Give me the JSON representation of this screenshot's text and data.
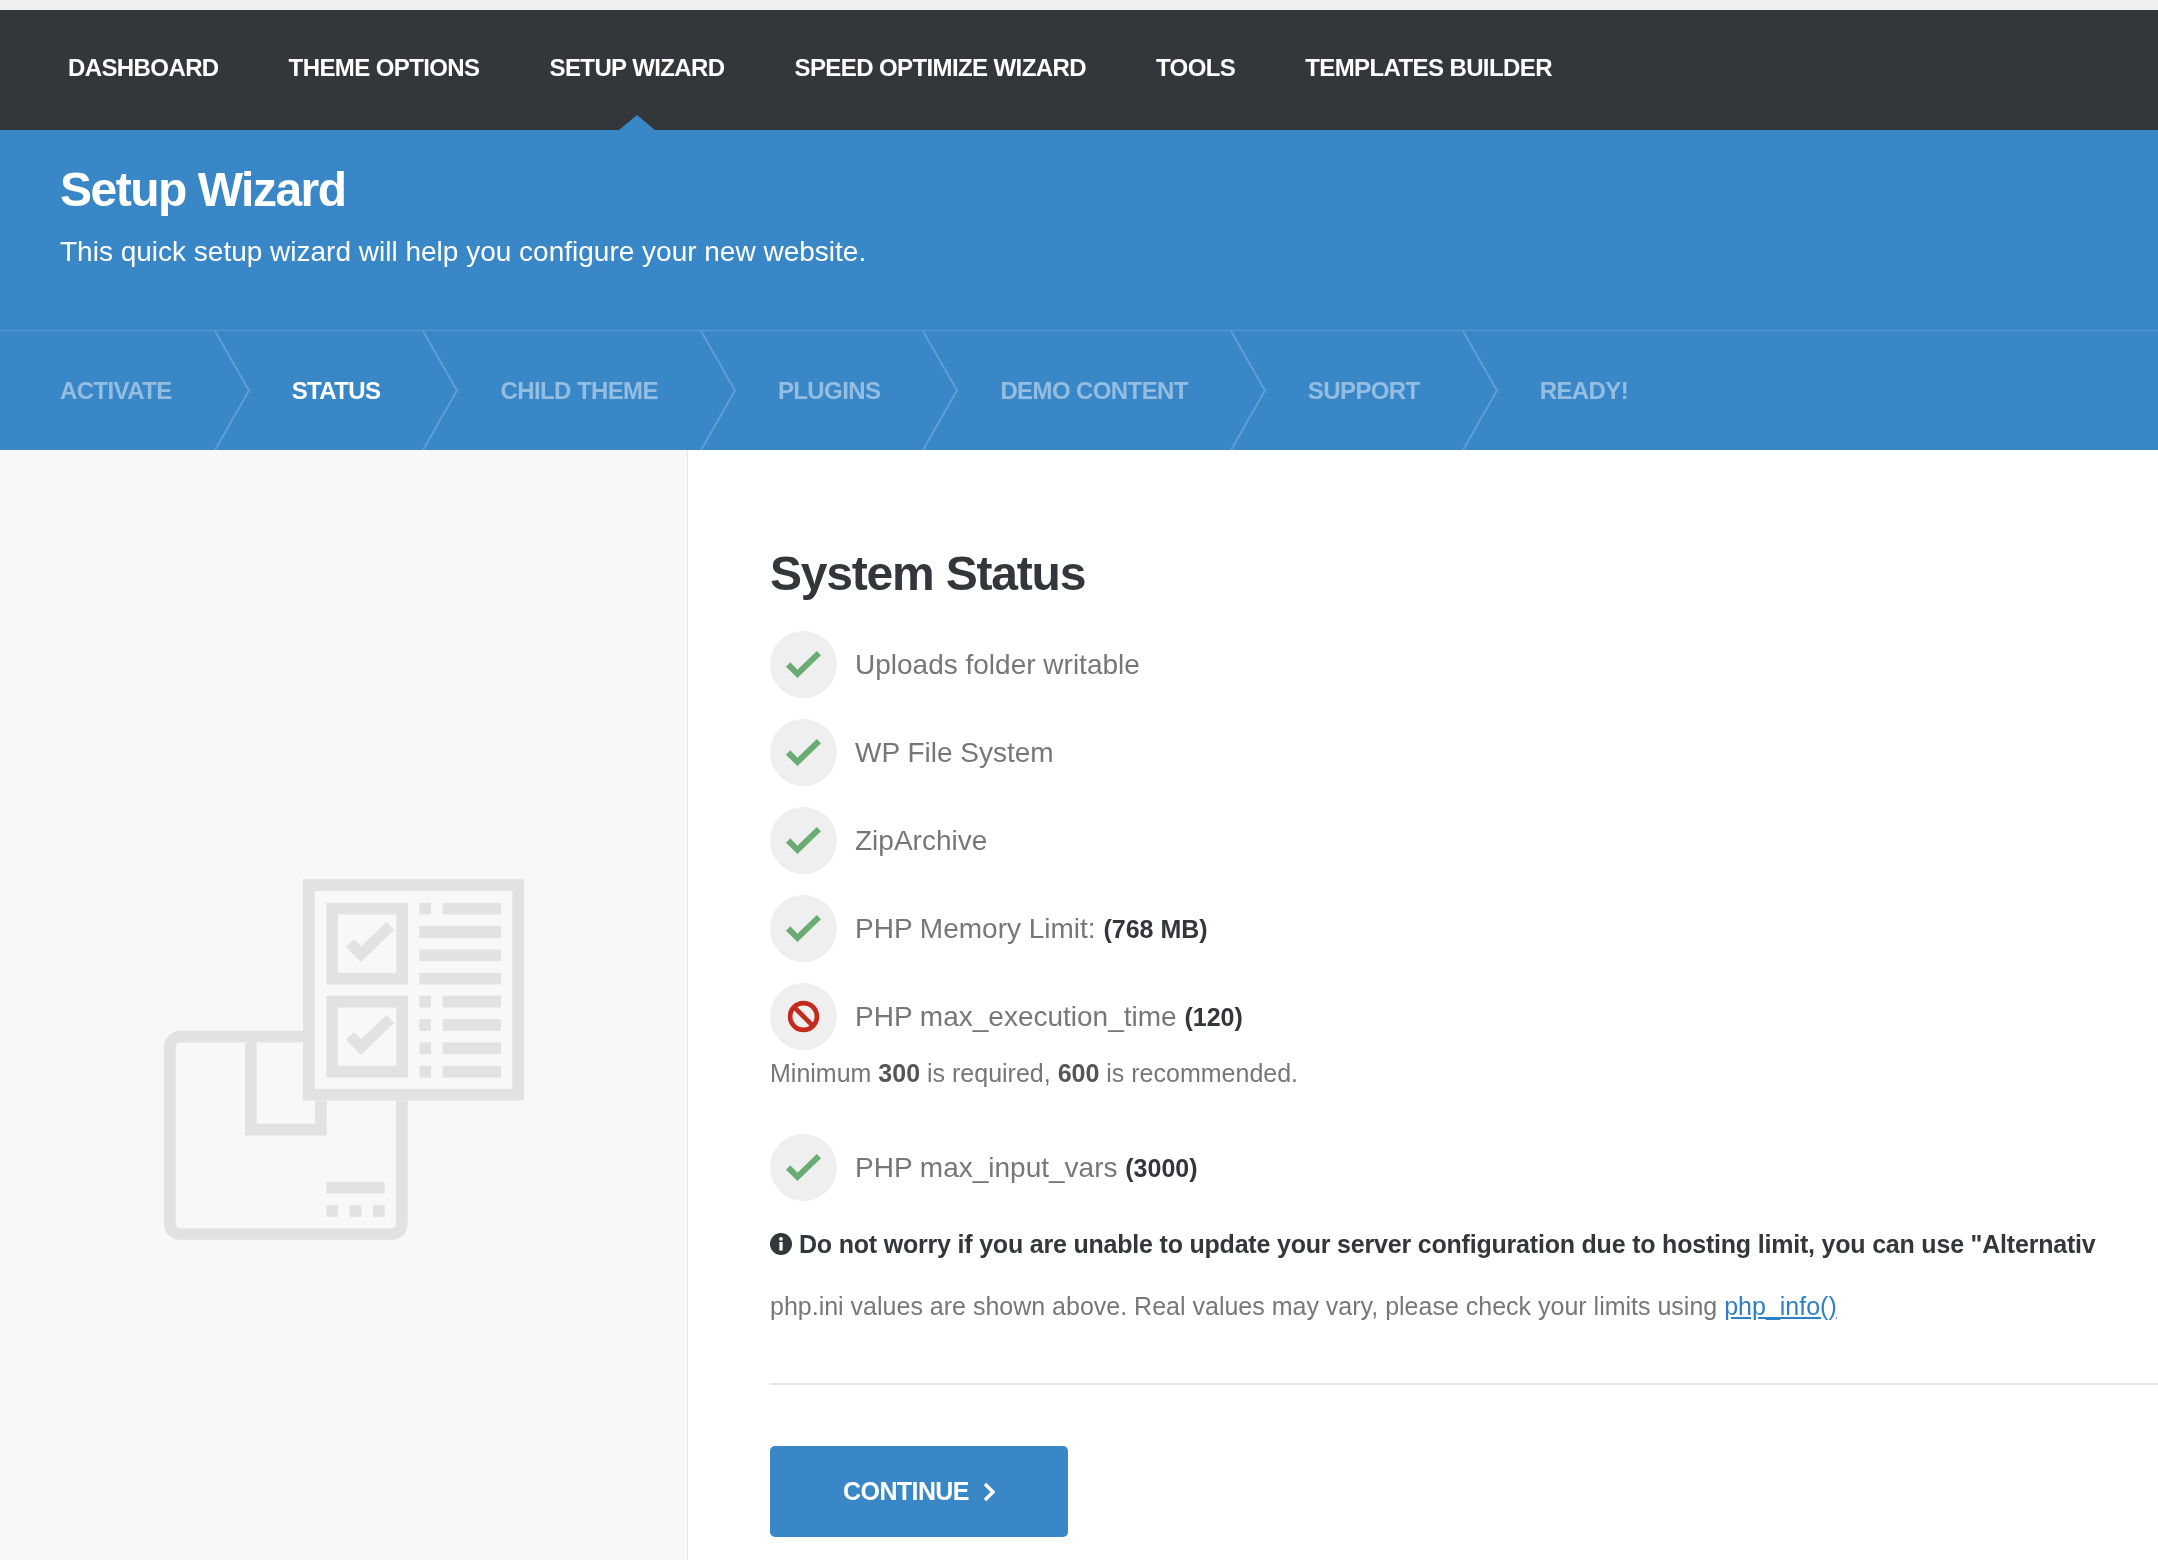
{
  "nav": {
    "items": [
      {
        "label": "DASHBOARD",
        "selected": false
      },
      {
        "label": "THEME OPTIONS",
        "selected": false
      },
      {
        "label": "SETUP WIZARD",
        "selected": true
      },
      {
        "label": "SPEED OPTIMIZE WIZARD",
        "selected": false
      },
      {
        "label": "TOOLS",
        "selected": false
      },
      {
        "label": "TEMPLATES BUILDER",
        "selected": false
      }
    ]
  },
  "header": {
    "title": "Setup Wizard",
    "subtitle": "This quick setup wizard will help you configure your new website."
  },
  "steps": [
    {
      "label": "ACTIVATE",
      "selected": false
    },
    {
      "label": "STATUS",
      "selected": true
    },
    {
      "label": "CHILD THEME",
      "selected": false
    },
    {
      "label": "PLUGINS",
      "selected": false
    },
    {
      "label": "DEMO CONTENT",
      "selected": false
    },
    {
      "label": "SUPPORT",
      "selected": false
    },
    {
      "label": "READY!",
      "selected": false
    }
  ],
  "status": {
    "title": "System Status",
    "checks": [
      {
        "label": "Uploads folder writable",
        "passed": true
      },
      {
        "label": "WP File System",
        "passed": true
      },
      {
        "label": "ZipArchive",
        "passed": true
      },
      {
        "label": "PHP Memory Limit:",
        "value": "(768 MB)",
        "passed": true
      },
      {
        "label": "PHP max_execution_time",
        "value": "(120)",
        "passed": false,
        "note": "Minimum **300** is required, **600** is recommended."
      },
      {
        "label": "PHP max_input_vars",
        "value": "(3000)",
        "passed": true
      }
    ],
    "notice": "Do not worry if you are unable to update your server configuration due to hosting limit, you can use \"Alternativ",
    "info_text": "php.ini values are shown above. Real values may vary, please check your limits using",
    "info_link": "php_info()",
    "continue_button": {
      "label": "CONTINUE"
    }
  }
}
